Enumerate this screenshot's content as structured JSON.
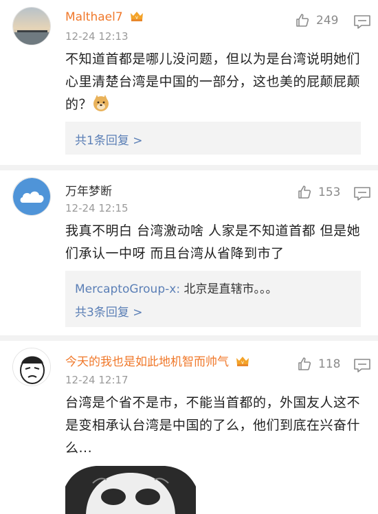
{
  "comments": [
    {
      "username": "Malthael7",
      "time": "12-24 12:13",
      "likes": "249",
      "text": "不知道首都是哪儿没问题，但以为是台湾说明她们心里清楚台湾是中国的一部分，这也美的屁颠屁颠的？",
      "replies_summary": "共1条回复 >"
    },
    {
      "username": "万年梦断",
      "time": "12-24 12:15",
      "likes": "153",
      "text": "我真不明白 台湾激动啥 人家是不知道首都 但是她们承认一中呀 而且台湾从省降到市了",
      "reply_preview_user": "MercaptoGroup-x:",
      "reply_preview_text": " 北京是直辖市。。。",
      "replies_summary": "共3条回复 >"
    },
    {
      "username": "今天的我也是如此地机智而帅气",
      "time": "12-24 12:17",
      "likes": "118",
      "text": "台湾是个省不是市，不能当首都的，外国友人这不是变相承认台湾是中国的了么，他们到底在兴奋什么..."
    }
  ],
  "colors": {
    "vip_name": "#f0782a",
    "link": "#5b7fb6",
    "reply_box": "#f3f3f3",
    "time": "#9a9a9a"
  }
}
